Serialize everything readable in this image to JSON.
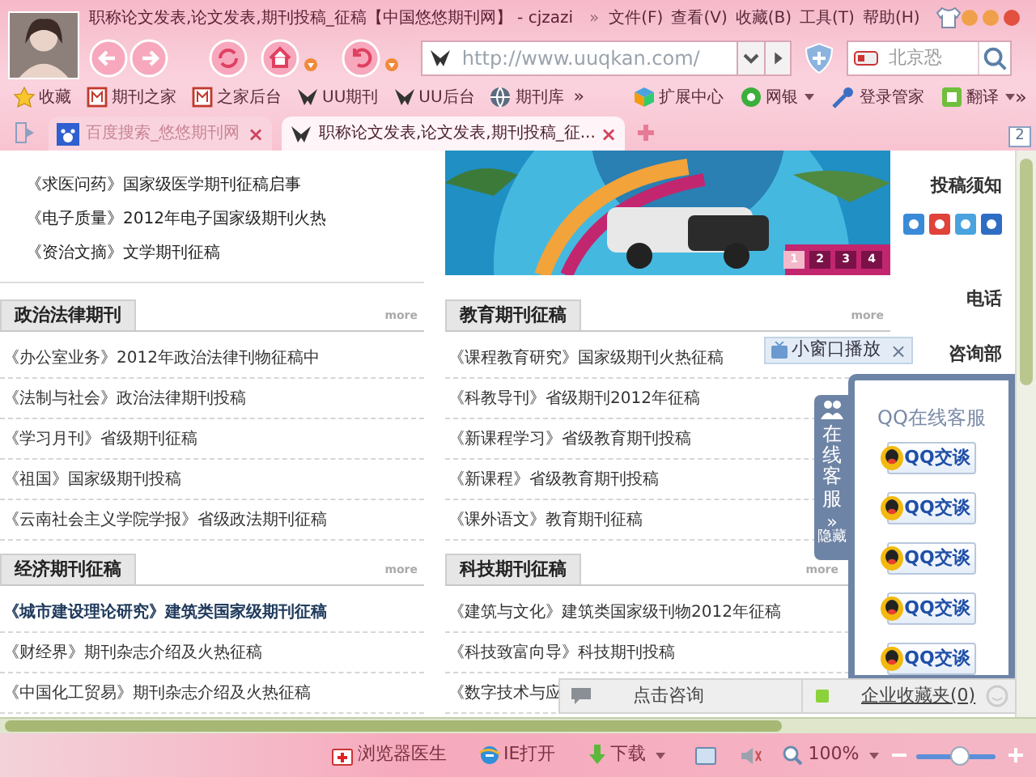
{
  "window": {
    "title": "职称论文发表,论文发表,期刊投稿_征稿【中国悠悠期刊网】 - cjzazi",
    "menu_overflow": "»",
    "menu": [
      "文件(F)",
      "查看(V)",
      "收藏(B)",
      "工具(T)",
      "帮助(H)"
    ]
  },
  "toolbar": {
    "address": "http://www.uuqkan.com/",
    "search": "北京恐"
  },
  "bookmarks": [
    {
      "label": "收藏",
      "kind": "star"
    },
    {
      "label": "期刊之家",
      "kind": "page"
    },
    {
      "label": "之家后台",
      "kind": "page"
    },
    {
      "label": "UU期刊",
      "kind": "uu"
    },
    {
      "label": "UU后台",
      "kind": "uu"
    },
    {
      "label": "期刊库",
      "kind": "globe"
    }
  ],
  "bookmarks_overflow": "»",
  "extensions": [
    {
      "label": "扩展中心",
      "kind": "cube",
      "dropdown": false
    },
    {
      "label": "网银",
      "kind": "coin",
      "dropdown": true
    },
    {
      "label": "登录管家",
      "kind": "key",
      "dropdown": false
    },
    {
      "label": "翻译",
      "kind": "translate",
      "dropdown": true
    }
  ],
  "extensions_overflow": "»",
  "tabs": [
    {
      "label": "百度搜索_悠悠期刊网",
      "close": "×",
      "selected": false
    },
    {
      "label": "职称论文发表,论文发表,期刊投稿_征...",
      "close": "×",
      "selected": true
    }
  ],
  "tab_count": "2",
  "top_links": [
    "《求医问药》国家级医学期刊征稿启事",
    "《电子质量》2012年电子国家级期刊火热",
    "《资治文摘》文学期刊征稿"
  ],
  "banner": {
    "kind": "picture",
    "pages": [
      {
        "label": "1",
        "selected": true
      },
      {
        "label": "2",
        "selected": false
      },
      {
        "label": "3",
        "selected": false
      },
      {
        "label": "4",
        "selected": false
      }
    ]
  },
  "right_panel": {
    "heading": "投稿须知",
    "labels": [
      "电话",
      "咨询部"
    ]
  },
  "sections": [
    {
      "title": "政治法律期刊",
      "more": "more",
      "items": [
        {
          "text": "《办公室业务》2012年政治法律刊物征稿中",
          "bold": false
        },
        {
          "text": "《法制与社会》政治法律期刊投稿",
          "bold": false
        },
        {
          "text": "《学习月刊》省级期刊征稿",
          "bold": false
        },
        {
          "text": "《祖国》国家级期刊投稿",
          "bold": false
        },
        {
          "text": "《云南社会主义学院学报》省级政法期刊征稿",
          "bold": false
        }
      ]
    },
    {
      "title": "教育期刊征稿",
      "more": "more",
      "items": [
        {
          "text": "《课程教育研究》国家级期刊火热征稿",
          "bold": false
        },
        {
          "text": "《科教导刊》省级期刊2012年征稿",
          "bold": false
        },
        {
          "text": "《新课程学习》省级教育期刊投稿",
          "bold": false
        },
        {
          "text": "《新课程》省级教育期刊投稿",
          "bold": false
        },
        {
          "text": "《课外语文》教育期刊征稿",
          "bold": false
        }
      ]
    },
    {
      "title": "经济期刊征稿",
      "more": "more",
      "items": [
        {
          "text": "《城市建设理论研究》建筑类国家级期刊征稿",
          "bold": true
        },
        {
          "text": "《财经界》期刊杂志介绍及火热征稿",
          "bold": false
        },
        {
          "text": "《中国化工贸易》期刊杂志介绍及火热征稿",
          "bold": false
        }
      ]
    },
    {
      "title": "科技期刊征稿",
      "more": "more",
      "items": [
        {
          "text": "《建筑与文化》建筑类国家级刊物2012年征稿",
          "bold": false
        },
        {
          "text": "《科技致富向导》科技期刊投稿",
          "bold": false
        },
        {
          "text": "《数字技术与应",
          "bold": false
        }
      ]
    }
  ],
  "video_popup": {
    "label": "小窗口播放",
    "close": "×"
  },
  "qq_panel": {
    "tab_label": "在线客服",
    "hide_arrows": "»",
    "hide_label": "隐藏",
    "title": "QQ在线客服",
    "buttons": [
      "QQ交谈",
      "QQ交谈",
      "QQ交谈",
      "QQ交谈",
      "QQ交谈"
    ]
  },
  "chat_bar": {
    "consult": "点击咨询",
    "favorites": "企业收藏夹(0)"
  },
  "status_bar": {
    "doctor": "浏览器医生",
    "ie_open": "IE打开",
    "download": "下载",
    "zoom": "100%",
    "zoom_slider": {
      "level": 0.55
    }
  }
}
